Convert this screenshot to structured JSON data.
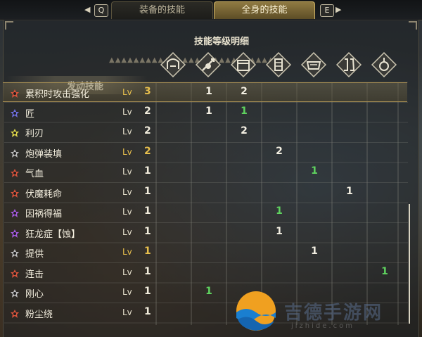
{
  "tabs": {
    "left_key": "Q",
    "right_key": "E",
    "items": [
      {
        "label": "装备的技能",
        "active": false
      },
      {
        "label": "全身的技能",
        "active": true
      }
    ]
  },
  "panel": {
    "title": "技能等级明细",
    "skills_header": "发动技能",
    "level_icons": [
      "head-armor-icon",
      "weapon-icon",
      "chest-armor-icon",
      "arm-armor-icon",
      "waist-armor-icon",
      "leg-armor-icon",
      "charm-icon"
    ]
  },
  "skills": [
    {
      "name": "累积时攻击强化",
      "lv_label": "Lv",
      "level": "3",
      "level_color": "gold",
      "icon_color": "#d8533c",
      "cells": [
        "",
        "1",
        "2",
        "",
        "",
        "",
        "",
        ""
      ],
      "green": [],
      "selected": true
    },
    {
      "name": "匠",
      "lv_label": "Lv",
      "level": "2",
      "level_color": "normal",
      "icon_color": "#6f6fe0",
      "cells": [
        "",
        "1",
        "1",
        "",
        "",
        "",
        "",
        ""
      ],
      "green": [
        2
      ],
      "selected": false
    },
    {
      "name": "利刃",
      "lv_label": "Lv",
      "level": "2",
      "level_color": "normal",
      "icon_color": "#e0d84a",
      "cells": [
        "",
        "",
        "2",
        "",
        "",
        "",
        "",
        ""
      ],
      "green": [],
      "selected": false
    },
    {
      "name": "炮弹装填",
      "lv_label": "Lv",
      "level": "2",
      "level_color": "gold",
      "icon_color": "#bdbdbd",
      "cells": [
        "",
        "",
        "",
        "2",
        "",
        "",
        "",
        ""
      ],
      "green": [],
      "selected": false
    },
    {
      "name": "气血",
      "lv_label": "Lv",
      "level": "1",
      "level_color": "normal",
      "icon_color": "#d8533c",
      "cells": [
        "",
        "",
        "",
        "",
        "1",
        "",
        "",
        ""
      ],
      "green": [
        4
      ],
      "selected": false
    },
    {
      "name": "伏魔耗命",
      "lv_label": "Lv",
      "level": "1",
      "level_color": "normal",
      "icon_color": "#d8533c",
      "cells": [
        "",
        "",
        "",
        "",
        "",
        "1",
        "",
        ""
      ],
      "green": [],
      "selected": false
    },
    {
      "name": "因祸得福",
      "lv_label": "Lv",
      "level": "1",
      "level_color": "normal",
      "icon_color": "#a65ae0",
      "cells": [
        "",
        "",
        "",
        "1",
        "",
        "",
        "",
        ""
      ],
      "green": [
        3
      ],
      "selected": false
    },
    {
      "name": "狂龙症【蚀】",
      "lv_label": "Lv",
      "level": "1",
      "level_color": "normal",
      "icon_color": "#a65ae0",
      "cells": [
        "",
        "",
        "",
        "1",
        "",
        "",
        "",
        ""
      ],
      "green": [],
      "selected": false
    },
    {
      "name": "提供",
      "lv_label": "Lv",
      "level": "1",
      "level_color": "gold",
      "icon_color": "#bdbdbd",
      "cells": [
        "",
        "",
        "",
        "",
        "1",
        "",
        "",
        ""
      ],
      "green": [],
      "selected": false
    },
    {
      "name": "连击",
      "lv_label": "Lv",
      "level": "1",
      "level_color": "normal",
      "icon_color": "#d8533c",
      "cells": [
        "",
        "",
        "",
        "",
        "",
        "",
        "1",
        ""
      ],
      "green": [
        6
      ],
      "selected": false
    },
    {
      "name": "刚心",
      "lv_label": "Lv",
      "level": "1",
      "level_color": "normal",
      "icon_color": "#bdbdbd",
      "cells": [
        "",
        "1",
        "",
        "",
        "",
        "",
        "",
        ""
      ],
      "green": [
        1
      ],
      "selected": false
    },
    {
      "name": "粉尘绕",
      "lv_label": "Lv",
      "level": "1",
      "level_color": "normal",
      "icon_color": "#d8533c",
      "cells": [
        "",
        "",
        "",
        "",
        "",
        "",
        "",
        ""
      ],
      "green": [],
      "selected": false
    }
  ],
  "watermark": {
    "text": "吉德手游网",
    "sub": "jizhide.com"
  }
}
